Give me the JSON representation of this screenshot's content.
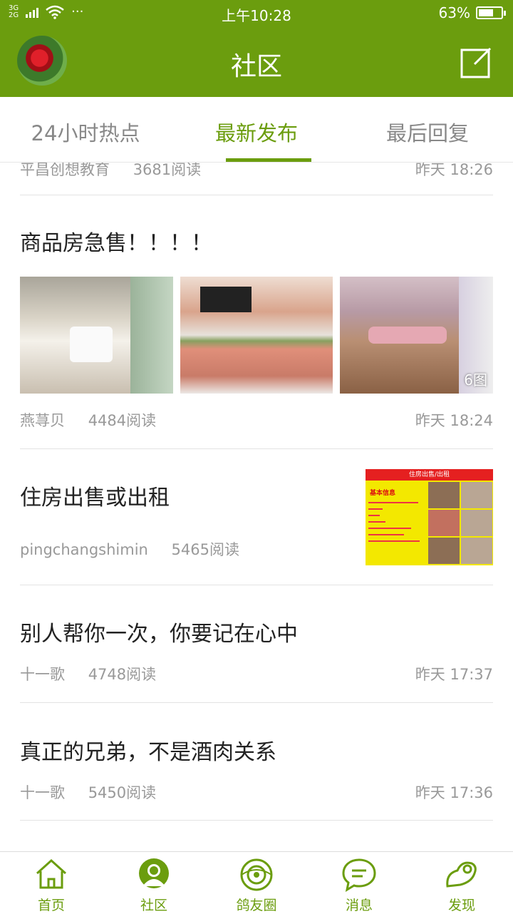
{
  "status_bar": {
    "network": "3G\n2G",
    "dots": "···",
    "time": "上午10:28",
    "battery": "63%"
  },
  "header": {
    "title": "社区"
  },
  "tabs": [
    {
      "label": "24小时热点"
    },
    {
      "label": "最新发布"
    },
    {
      "label": "最后回复"
    }
  ],
  "feed": {
    "partial_row": {
      "author": "平昌创想教育",
      "reads": "3681阅读",
      "time": "昨天 18:26"
    },
    "posts": [
      {
        "title": "商品房急售！！！！",
        "image_count": "6图",
        "author": "燕荨贝",
        "reads": "4484阅读",
        "time": "昨天 18:24"
      },
      {
        "title": "住房出售或出租",
        "flyer_header": "住房出售/出租",
        "flyer_basic": "基本信息",
        "author": "pingchangshimin",
        "reads": "5465阅读",
        "time": ""
      },
      {
        "title": "别人帮你一次，你要记在心中",
        "author": "十一歌",
        "reads": "4748阅读",
        "time": "昨天 17:37"
      },
      {
        "title": "真正的兄弟，不是酒肉关系",
        "author": "十一歌",
        "reads": "5450阅读",
        "time": "昨天 17:36"
      }
    ]
  },
  "bottom_nav": [
    {
      "label": "首页",
      "icon": "home-icon"
    },
    {
      "label": "社区",
      "icon": "community-icon"
    },
    {
      "label": "鸽友圈",
      "icon": "pigeon-circle-icon"
    },
    {
      "label": "消息",
      "icon": "message-icon"
    },
    {
      "label": "发现",
      "icon": "discover-icon"
    }
  ],
  "colors": {
    "brand": "#6b9d0e",
    "text_secondary": "#999999"
  }
}
